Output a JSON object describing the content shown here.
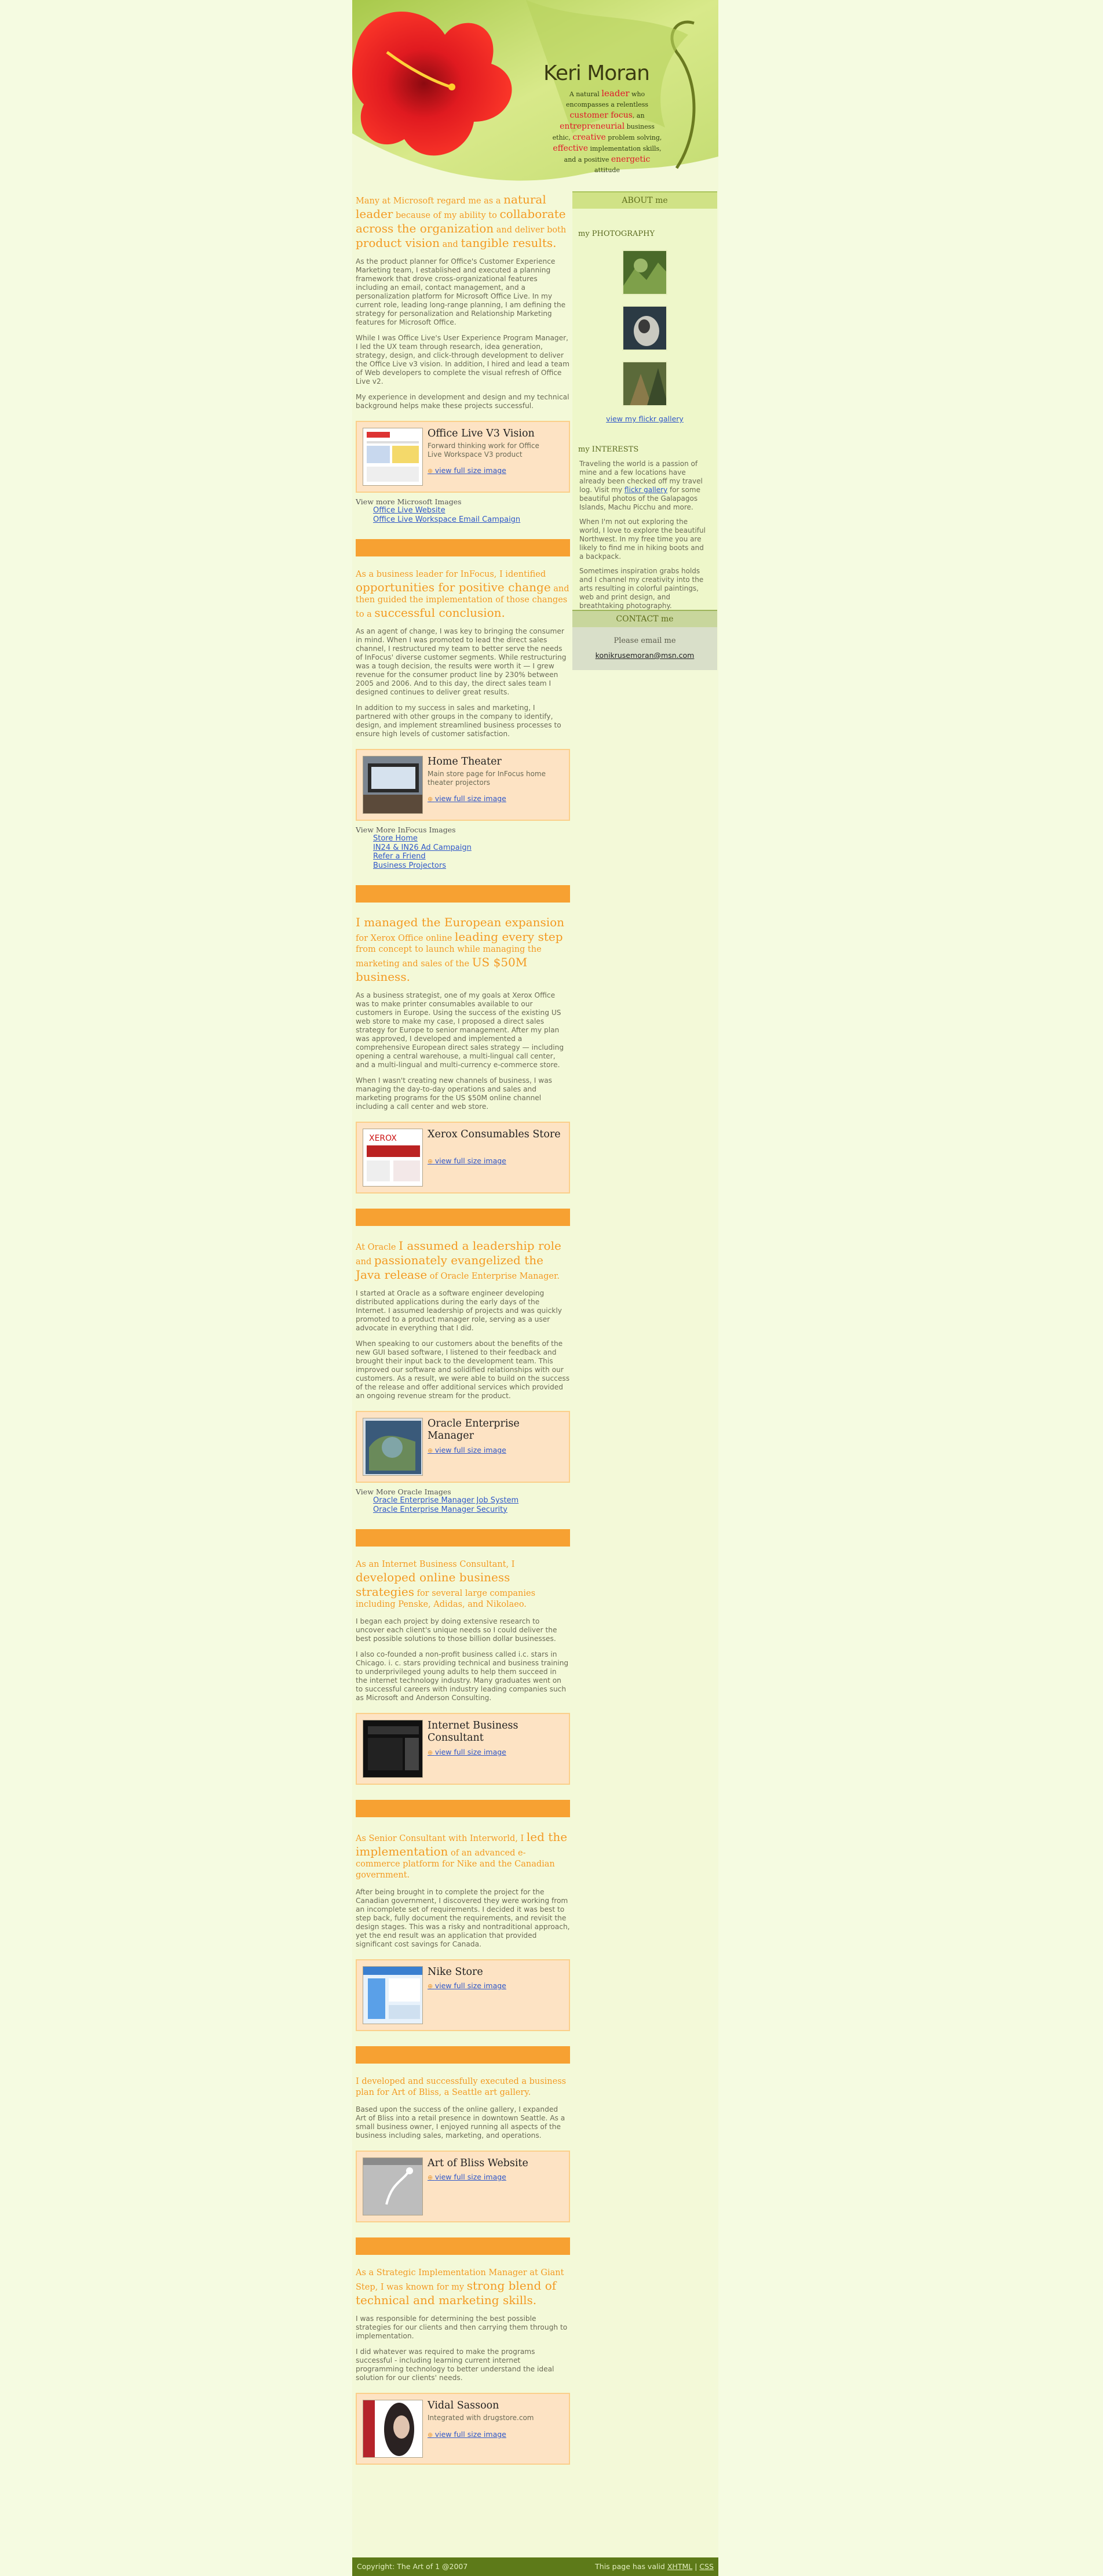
{
  "header": {
    "name": "Keri Moran",
    "tagline": [
      [
        "A natural ",
        ""
      ],
      [
        "leader",
        "hl"
      ],
      [
        " who encompasses a relentless ",
        ""
      ],
      [
        "customer focus",
        ""
      ],
      [
        ", an ",
        ""
      ],
      [
        "entrepreneurial",
        ""
      ],
      [
        " business ethic, ",
        ""
      ],
      [
        "creative",
        ""
      ],
      [
        " problem solving, ",
        ""
      ],
      [
        "effective",
        ""
      ],
      [
        " implementation skills, and a positive ",
        ""
      ],
      [
        "energetic",
        ""
      ],
      [
        " attitude",
        ""
      ]
    ]
  },
  "sections": [
    {
      "intro": [
        [
          "Many at Microsoft regard me as a ",
          0
        ],
        [
          "natural leader",
          1
        ],
        [
          " because of my ability to ",
          0
        ],
        [
          "collaborate across the organization",
          1
        ],
        [
          " and deliver both ",
          0
        ],
        [
          "product vision",
          1
        ],
        [
          " and ",
          0
        ],
        [
          "tangible results.",
          1
        ]
      ],
      "paras": [
        "As the product planner for Office's Customer Experience Marketing team, I established and executed a planning framework that drove cross-organizational features including an email, contact management, and a personalization platform for Microsoft Office Live. In my current role, leading long-range planning, I am defining the strategy for personalization and Relationship Marketing features for Microsoft Office.",
        "While I was Office Live's User Experience Program Manager, I led the UX team through research, idea generation, strategy, design, and click-through development to deliver the Office Live v3 vision. In addition, I hired and lead a team of Web developers to complete the visual refresh of Office Live v2.",
        "My experience in development and design and my technical background helps make these projects successful."
      ],
      "card": {
        "title": "Office Live V3 Vision",
        "desc": "Forward thinking work for Office Live Workspace V3 product",
        "link": "view full size image"
      },
      "more": "View more Microsoft Images",
      "links": [
        "Office Live Website",
        "Office Live Workspace Email Campaign"
      ]
    },
    {
      "intro": [
        [
          "As a business leader for InFocus, I identified ",
          0
        ],
        [
          "opportunities for positive change",
          1
        ],
        [
          " and then guided the implementation of those changes to a ",
          0
        ],
        [
          "successful conclusion.",
          1
        ]
      ],
      "paras": [
        "As an agent of change, I was key to bringing the consumer in mind. When I was promoted to lead the direct sales channel, I restructured my team to better serve the needs of InFocus' diverse customer segments. While restructuring was a tough decision, the results were worth it — I grew revenue for the consumer product line by 230% between 2005 and 2006. And to this day, the direct sales team I designed continues to deliver great results.",
        "In addition to my success in sales and marketing, I partnered with other groups in the company to identify, design, and implement streamlined business processes to ensure high levels of customer satisfaction."
      ],
      "card": {
        "title": "Home Theater",
        "desc": "Main store page for InFocus home theater projectors",
        "link": "view full size image"
      },
      "more": "View More InFocus Images",
      "links": [
        "Store Home",
        "IN24 & IN26 Ad Campaign",
        "Refer a Friend",
        "Business Projectors"
      ]
    },
    {
      "intro": [
        [
          "I managed the European expansion",
          1
        ],
        [
          " for Xerox Office online ",
          0
        ],
        [
          "leading every step",
          1
        ],
        [
          " from concept to launch while managing the marketing and sales of the ",
          0
        ],
        [
          "US $50M business.",
          1
        ]
      ],
      "paras": [
        "As a business strategist, one of my goals at Xerox Office was to make printer consumables available to our customers in Europe. Using the success of the existing US web store to make my case, I proposed a direct sales strategy for Europe to senior management. After my plan was approved, I developed and implemented a comprehensive European direct sales strategy — including opening a central warehouse, a multi-lingual call center, and a multi-lingual and multi-currency e-commerce store.",
        "When I wasn't creating new channels of business, I was managing the day-to-day operations and sales and marketing programs for the US $50M online channel including a call center and web store."
      ],
      "card": {
        "title": "Xerox Consumables Store",
        "desc": "",
        "link": "view full size image"
      },
      "more": "",
      "links": []
    },
    {
      "intro": [
        [
          "At Oracle ",
          0
        ],
        [
          "I assumed a leadership role",
          1
        ],
        [
          " and ",
          0
        ],
        [
          "passionately evangelized the Java release",
          1
        ],
        [
          " of Oracle Enterprise Manager.",
          0
        ]
      ],
      "paras": [
        "I started at Oracle as a software engineer developing distributed applications during the early days of the Internet. I assumed leadership of projects and was quickly promoted to a product manager role, serving as a user advocate in everything that I did.",
        "When speaking to our customers about the benefits of the new GUI based software, I listened to their feedback and brought their input back to the development team. This improved our software and solidified relationships with our customers. As a result, we were able to build on the success of the release and offer additional services which provided an ongoing revenue stream for the product."
      ],
      "card": {
        "title": "Oracle Enterprise Manager",
        "desc": "",
        "link": "view full size image"
      },
      "more": "View More Oracle Images",
      "links": [
        "Oracle Enterprise Manager Job System",
        "Oracle Enterprise Manager Security"
      ]
    },
    {
      "intro": [
        [
          "As an Internet Business Consultant, I ",
          0
        ],
        [
          "developed online business strategies",
          1
        ],
        [
          " for several large companies including Penske, Adidas, and Nikolaeo.",
          0
        ]
      ],
      "paras": [
        "I began each project by doing extensive research to uncover each client's unique needs so I could deliver the best possible solutions to those billion dollar businesses.",
        "I also co-founded a non-profit business called i.c. stars in Chicago. i. c. stars providing technical and business training to underprivileged young adults to help them succeed in the internet technology industry. Many graduates went on to successful careers with industry leading companies such as Microsoft and Anderson Consulting."
      ],
      "card": {
        "title": "Internet Business Consultant",
        "desc": "",
        "link": "view full size image"
      },
      "more": "",
      "links": []
    },
    {
      "intro": [
        [
          "As Senior Consultant with Interworld, I ",
          0
        ],
        [
          "led the implementation",
          1
        ],
        [
          " of an advanced e-commerce platform for Nike and the Canadian government.",
          0
        ]
      ],
      "paras": [
        "After being brought in to complete the project for the Canadian government, I discovered they were working from an incomplete set of requirements. I decided it was best to step back, fully document the requirements, and revisit the design stages. This was a risky and nontraditional approach, yet the end result was an application that provided significant cost savings for Canada."
      ],
      "card": {
        "title": "Nike Store",
        "desc": "",
        "link": "view full size image"
      },
      "more": "",
      "links": []
    },
    {
      "intro": [
        [
          "I developed and successfully executed a business plan for Art of Bliss, a Seattle art gallery.",
          0
        ]
      ],
      "paras": [
        "Based upon the success of the online gallery, I expanded Art of Bliss into a retail presence in downtown Seattle. As a small business owner, I enjoyed running all aspects of the business including sales, marketing, and operations."
      ],
      "card": {
        "title": "Art of Bliss Website",
        "desc": "",
        "link": "view full size image"
      },
      "more": "",
      "links": []
    },
    {
      "intro": [
        [
          "As a Strategic Implementation Manager at Giant Step, I was known for my ",
          0
        ],
        [
          "strong blend of technical and marketing skills.",
          1
        ]
      ],
      "paras": [
        "I was responsible for determining the best possible strategies for our clients and then carrying them through to implementation.",
        "I did whatever was required to make the programs successful - including learning current internet programming technology to better understand the ideal solution for our clients' needs."
      ],
      "card": {
        "title": "Vidal Sassoon",
        "desc": "Integrated with drugstore.com",
        "link": "view full size image"
      },
      "more": "",
      "links": []
    }
  ],
  "about": {
    "heading": "ABOUT me",
    "photo_title": "my PHOTOGRAPHY",
    "flickr": "view my flickr gallery",
    "interests_title": "my INTERESTS",
    "interests": [
      [
        "Traveling the world is a passion of mine and a few locations have already been checked off my travel log. Visit my ",
        ""
      ],
      [
        "flickr gallery",
        "link"
      ],
      [
        " for some beautiful photos of the Galapagos Islands, Machu Picchu and more.",
        ""
      ]
    ],
    "p2": "When I'm not out exploring the world, I love to explore the beautiful Northwest. In my free time you are likely to find me in hiking boots and a backpack.",
    "p3": "Sometimes inspiration grabs holds and I channel my creativity into the arts resulting in colorful paintings, web and print design, and breathtaking photography."
  },
  "contact": {
    "heading": "CONTACT me",
    "please": "Please email me",
    "email": "konikrusemoran@msn.com"
  },
  "footer": {
    "copyright": "Copyright: The Art of 1 @2007",
    "valid_prefix": "This page has valid ",
    "html": "XHTML",
    "sep": " | ",
    "css": "CSS"
  },
  "colors": {
    "bg": "#f5fbe1",
    "orange": "#f7a132",
    "green": "#5d7a19",
    "link": "#2f57c9"
  }
}
